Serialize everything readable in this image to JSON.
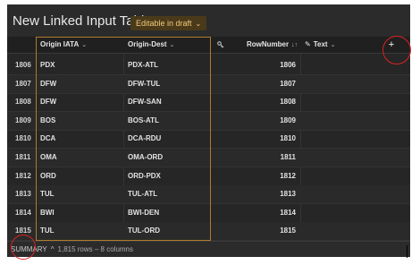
{
  "title": "New Linked Input Table",
  "badge": {
    "label": "Editable in draft",
    "chevron": "⌄"
  },
  "columns": {
    "origin_iata": "Origin IATA",
    "origin_dest": "Origin-Dest",
    "row_number": "RowNumber",
    "text": "Text",
    "dropdown_glyph": "⌄",
    "sort_glyph": "↓↑",
    "key_icon": "key-icon",
    "pencil_icon": "pencil-icon",
    "add_glyph": "+"
  },
  "rows": [
    {
      "num": "1806",
      "iata": "PDX",
      "od": "PDX-ATL",
      "rn": "1806"
    },
    {
      "num": "1807",
      "iata": "DFW",
      "od": "DFW-TUL",
      "rn": "1807"
    },
    {
      "num": "1808",
      "iata": "DFW",
      "od": "DFW-SAN",
      "rn": "1808"
    },
    {
      "num": "1809",
      "iata": "BOS",
      "od": "BOS-ATL",
      "rn": "1809"
    },
    {
      "num": "1810",
      "iata": "DCA",
      "od": "DCA-RDU",
      "rn": "1810"
    },
    {
      "num": "1811",
      "iata": "OMA",
      "od": "OMA-ORD",
      "rn": "1811"
    },
    {
      "num": "1812",
      "iata": "ORD",
      "od": "ORD-PDX",
      "rn": "1812"
    },
    {
      "num": "1813",
      "iata": "TUL",
      "od": "TUL-ATL",
      "rn": "1813"
    },
    {
      "num": "1814",
      "iata": "BWI",
      "od": "BWI-DEN",
      "rn": "1814"
    },
    {
      "num": "1815",
      "iata": "TUL",
      "od": "TUL-ORD",
      "rn": "1815"
    }
  ],
  "footer": {
    "summary_label": "SUMMARY",
    "chevron_up": "^",
    "stats": "1,815 rows – 8 columns"
  },
  "colors": {
    "panel_bg": "#2b2b2b",
    "badge_bg": "#4a3a1a",
    "badge_text": "#f2c97a",
    "selection_border": "#b07a2e",
    "annotation_red": "#dd2222"
  }
}
